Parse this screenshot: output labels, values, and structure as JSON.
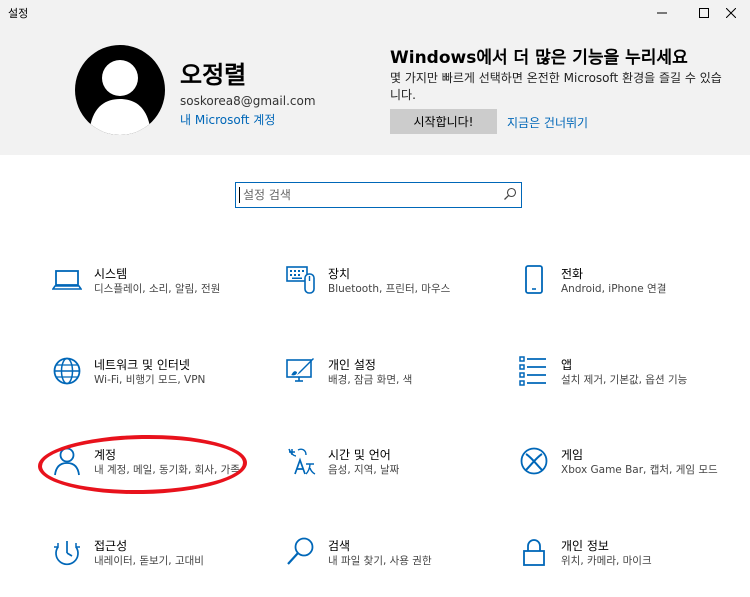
{
  "window": {
    "title": "설정"
  },
  "header": {
    "user_name": "오정렬",
    "user_email": "soskorea8@gmail.com",
    "account_link": "내 Microsoft 계정",
    "promo_title": "Windows에서 더 많은 기능을 누리세요",
    "promo_desc": "몇 가지만 빠르게 선택하면 온전한 Microsoft 환경을 즐길 수 있습니다.",
    "promo_button": "시작합니다!",
    "skip_link": "지금은 건너뛰기"
  },
  "search": {
    "placeholder": "설정 검색"
  },
  "colors": {
    "accent": "#0067b8",
    "highlight": "#e8121c",
    "header_bg": "#f2f2f2"
  },
  "tiles": [
    {
      "icon": "laptop-icon",
      "title": "시스템",
      "desc": "디스플레이, 소리, 알림, 전원"
    },
    {
      "icon": "keyboard-icon",
      "title": "장치",
      "desc": "Bluetooth, 프린터, 마우스"
    },
    {
      "icon": "phone-icon",
      "title": "전화",
      "desc": "Android, iPhone 연결"
    },
    {
      "icon": "globe-icon",
      "title": "네트워크 및 인터넷",
      "desc": "Wi-Fi, 비행기 모드, VPN"
    },
    {
      "icon": "paint-icon",
      "title": "개인 설정",
      "desc": "배경, 잠금 화면, 색"
    },
    {
      "icon": "apps-list-icon",
      "title": "앱",
      "desc": "설치 제거, 기본값, 옵션 기능"
    },
    {
      "icon": "person-icon",
      "title": "계정",
      "desc": "내 계정, 메일, 동기화, 회사, 가족"
    },
    {
      "icon": "time-language-icon",
      "title": "시간 및 언어",
      "desc": "음성, 지역, 날짜"
    },
    {
      "icon": "xbox-icon",
      "title": "게임",
      "desc": "Xbox Game Bar, 캡처, 게임 모드"
    },
    {
      "icon": "accessibility-icon",
      "title": "접근성",
      "desc": "내레이터, 돋보기, 고대비"
    },
    {
      "icon": "search-icon",
      "title": "검색",
      "desc": "내 파일 찾기, 사용 권한"
    },
    {
      "icon": "lock-icon",
      "title": "개인 정보",
      "desc": "위치, 카메라, 마이크"
    }
  ]
}
